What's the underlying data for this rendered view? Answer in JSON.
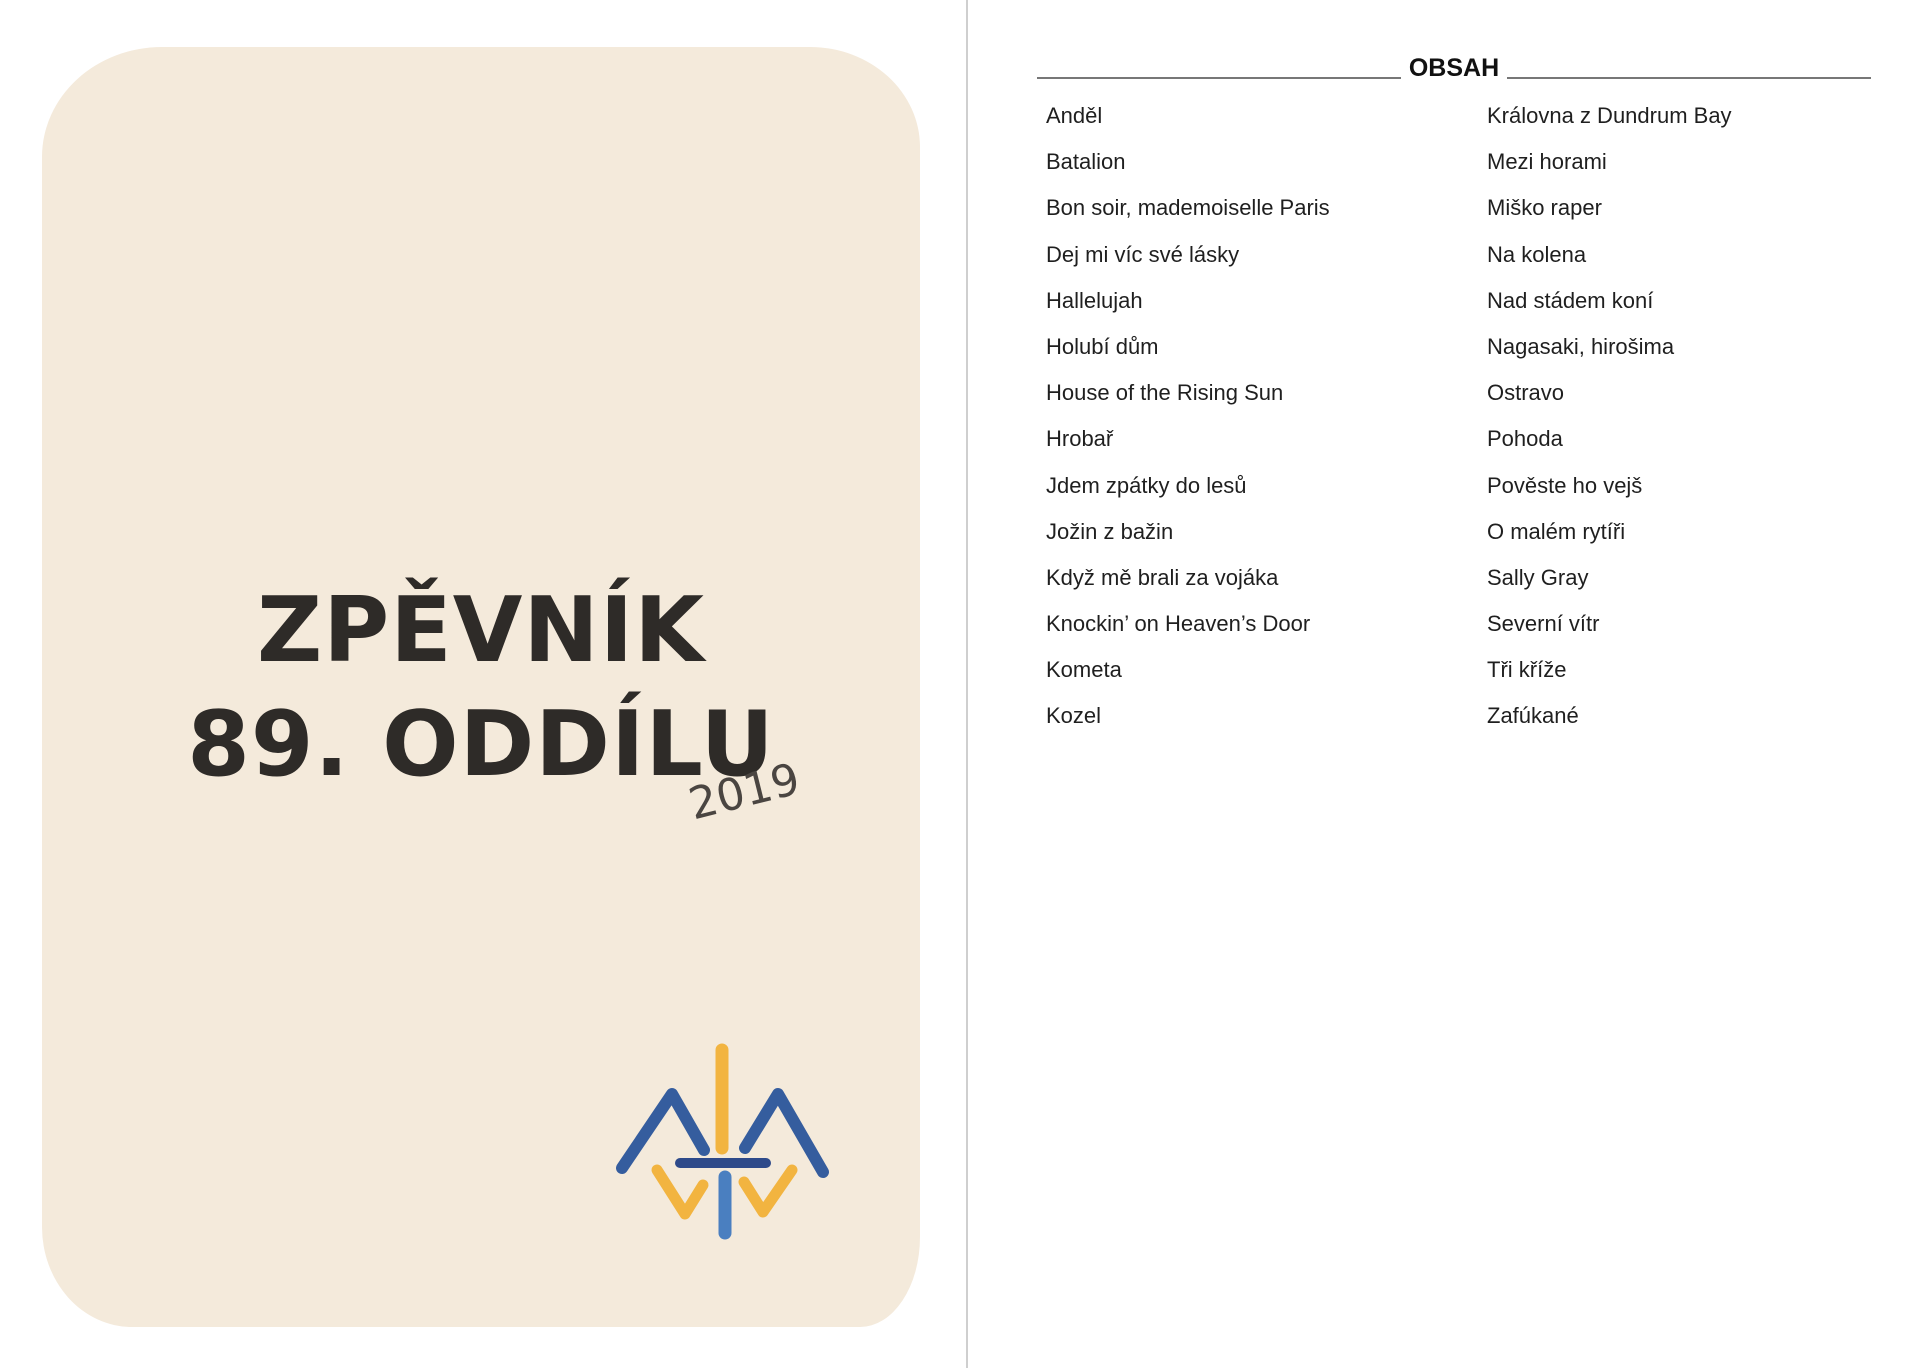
{
  "cover": {
    "title_line1": "ZPĚVNÍK",
    "title_line2": "89. ODDÍLU",
    "year": "2019",
    "logo_colors": {
      "blue": "#355d9e",
      "dark_blue": "#2e4a8a",
      "light_blue": "#4a7fc0",
      "yellow": "#f2b440"
    },
    "background_color": "#f4eadb"
  },
  "toc": {
    "heading": "OBSAH",
    "left_column": [
      "Anděl",
      "Batalion",
      "Bon soir, mademoiselle Paris",
      "Dej mi víc své lásky",
      "Hallelujah",
      "Holubí dům",
      "House of the Rising Sun",
      "Hrobař",
      "Jdem zpátky do lesů",
      "Jožin z bažin",
      "Když mě brali za vojáka",
      "Knockin’ on Heaven’s Door",
      "Kometa",
      "Kozel"
    ],
    "right_column": [
      "Královna z Dundrum Bay",
      "Mezi horami",
      "Miško raper",
      "Na kolena",
      "Nad stádem koní",
      "Nagasaki, hirošima",
      "Ostravo",
      "Pohoda",
      "Pověste ho vejš",
      "O malém rytíři",
      "Sally Gray",
      "Severní vítr",
      "Tři kříže",
      "Zafúkané"
    ]
  }
}
